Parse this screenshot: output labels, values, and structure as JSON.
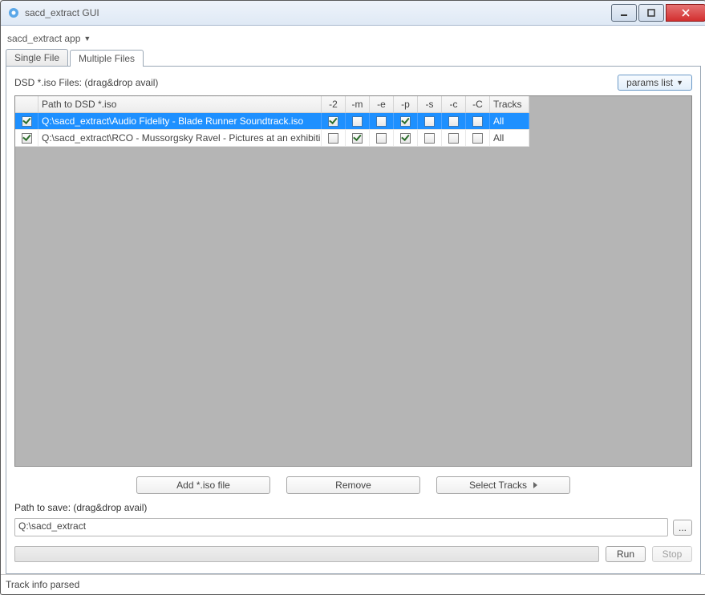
{
  "window": {
    "title": "sacd_extract GUI"
  },
  "menu": {
    "app_dropdown": "sacd_extract app"
  },
  "tabs": {
    "single": "Single File",
    "multiple": "Multiple Files",
    "active": "multiple"
  },
  "toolbar": {
    "dsd_label": "DSD *.iso Files: (drag&drop avail)",
    "params_list": "params list"
  },
  "grid": {
    "columns": {
      "path": "Path to DSD *.iso",
      "f2": "-2",
      "fm": "-m",
      "fe": "-e",
      "fp": "-p",
      "fs": "-s",
      "fc": "-c",
      "fC": "-C",
      "tracks": "Tracks"
    },
    "rows": [
      {
        "sel": true,
        "path": "Q:\\sacd_extract\\Audio Fidelity - Blade Runner Soundtrack.iso",
        "flags": {
          "f2": true,
          "fm": false,
          "fe": false,
          "fp": true,
          "fs": false,
          "fc": false,
          "fC": false
        },
        "tracks": "All",
        "selected_row": true
      },
      {
        "sel": true,
        "path": "Q:\\sacd_extract\\RCO - Mussorgsky Ravel - Pictures at an exhibition.iso",
        "flags": {
          "f2": false,
          "fm": true,
          "fe": false,
          "fp": true,
          "fs": false,
          "fc": false,
          "fC": false
        },
        "tracks": "All",
        "selected_row": false
      }
    ]
  },
  "actions": {
    "add": "Add *.iso file",
    "remove": "Remove",
    "select_tracks": "Select Tracks"
  },
  "save": {
    "label": "Path to save: (drag&drop avail)",
    "value": "Q:\\sacd_extract",
    "browse": "..."
  },
  "footer": {
    "run": "Run",
    "stop": "Stop"
  },
  "status": {
    "text": "Track info parsed"
  }
}
